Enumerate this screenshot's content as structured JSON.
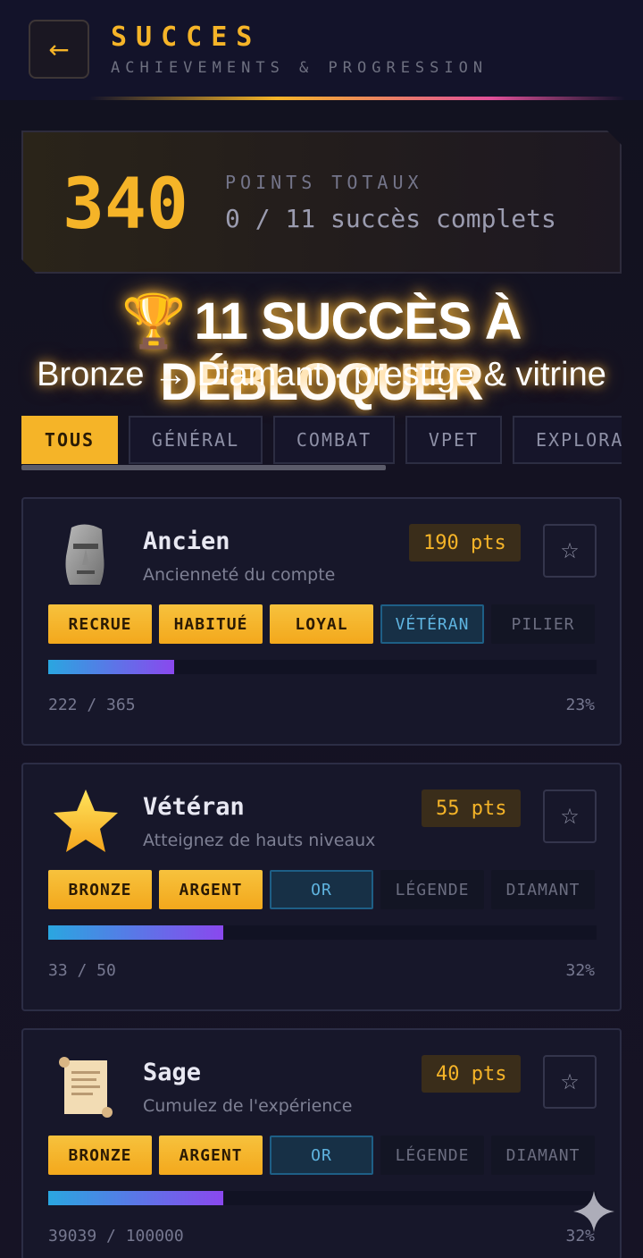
{
  "header": {
    "back_icon": "←",
    "title": "SUCCES",
    "subtitle": "ACHIEVEMENTS & PROGRESSION"
  },
  "summary": {
    "points": "340",
    "points_label": "POINTS TOTAUX",
    "completed": "0 / 11 succès complets"
  },
  "banner": {
    "trophy": "🏆",
    "title": "11 SUCCÈS À DÉBLOQUER",
    "subtitle": "Bronze → Diamant · prestige & vitrine"
  },
  "tabs": [
    {
      "label": "TOUS",
      "active": true
    },
    {
      "label": "GÉNÉRAL",
      "active": false
    },
    {
      "label": "COMBAT",
      "active": false
    },
    {
      "label": "VPET",
      "active": false
    },
    {
      "label": "EXPLORA",
      "active": false
    }
  ],
  "achievements": [
    {
      "icon": "moai-icon",
      "name": "Ancien",
      "description": "Ancienneté du compte",
      "points": "190 pts",
      "fav_icon": "☆",
      "tiers": [
        {
          "label": "RECRUE",
          "state": "done"
        },
        {
          "label": "HABITUÉ",
          "state": "done"
        },
        {
          "label": "LOYAL",
          "state": "done"
        },
        {
          "label": "VÉTÉRAN",
          "state": "current"
        },
        {
          "label": "PILIER",
          "state": "locked"
        }
      ],
      "progress": "222 / 365",
      "percent": "23%",
      "fill": 0.23
    },
    {
      "icon": "star-icon",
      "name": "Vétéran",
      "description": "Atteignez de hauts niveaux",
      "points": "55 pts",
      "fav_icon": "☆",
      "tiers": [
        {
          "label": "BRONZE",
          "state": "done"
        },
        {
          "label": "ARGENT",
          "state": "done"
        },
        {
          "label": "OR",
          "state": "current"
        },
        {
          "label": "LÉGENDE",
          "state": "locked"
        },
        {
          "label": "DIAMANT",
          "state": "locked"
        }
      ],
      "progress": "33 / 50",
      "percent": "32%",
      "fill": 0.32
    },
    {
      "icon": "scroll-icon",
      "name": "Sage",
      "description": "Cumulez de l'expérience",
      "points": "40 pts",
      "fav_icon": "☆",
      "tiers": [
        {
          "label": "BRONZE",
          "state": "done"
        },
        {
          "label": "ARGENT",
          "state": "done"
        },
        {
          "label": "OR",
          "state": "current"
        },
        {
          "label": "LÉGENDE",
          "state": "locked"
        },
        {
          "label": "DIAMANT",
          "state": "locked"
        }
      ],
      "progress": "39039 / 100000",
      "percent": "32%",
      "fill": 0.32
    }
  ]
}
